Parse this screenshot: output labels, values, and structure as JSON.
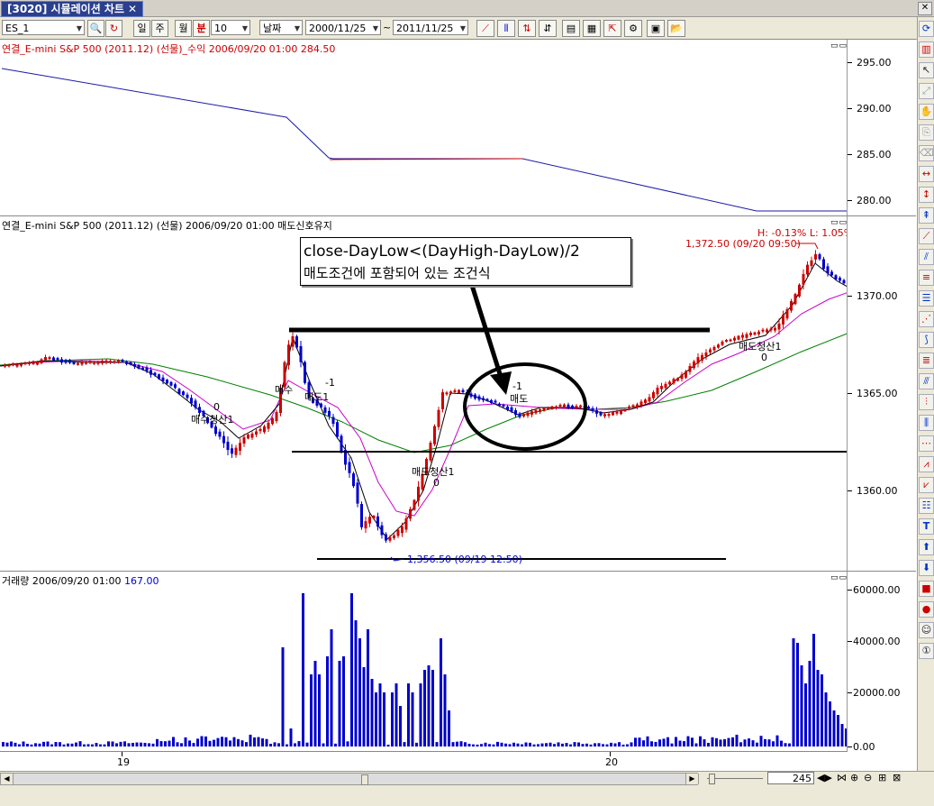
{
  "window": {
    "tab_title": "[3020] 시뮬레이션 차트",
    "close": "✕"
  },
  "toolbar": {
    "symbol": "ES_1",
    "period_btns": [
      "일",
      "주",
      "월",
      "분"
    ],
    "interval": "10",
    "range_type": "날짜",
    "date_from": "2000/11/25",
    "tilde": "~",
    "date_to": "2011/11/25"
  },
  "pane1": {
    "title": "연결_E-mini S&P 500 (2011.12) (선물)_수익 2006/09/20 01:00 284.50",
    "y_labels": [
      "295.00",
      "290.00",
      "285.00",
      "280.00"
    ]
  },
  "pane2": {
    "title": "연결_E-mini S&P 500 (2011.12) (선물)  2006/09/20 01:00  매도신호유지",
    "y_labels": [
      "1370.00",
      "1365.00",
      "1360.00"
    ],
    "hl_label": "H: -0.13%   L: 1.05%",
    "high_label": "1,372.50 (09/20 09:50)",
    "low_label": "1,356.50 (09/19 12:50)",
    "annotation_line1": "close-DayLow<(DayHigh-DayLow)/2",
    "annotation_line2": "매도조건에 포함되어 있는 조건식",
    "signals": {
      "s1_qty": "0",
      "s1_label": "매수청산1",
      "s2_label": "매수",
      "s3_label": "매도1",
      "s3_qty": "-1",
      "s4_label": "매도청산1",
      "s4_qty": "0",
      "s5_qty": "-1",
      "s5_label": "매도",
      "s6_label": "매도청산1",
      "s6_qty": "0"
    }
  },
  "pane3": {
    "title_prefix": "거래량  2006/09/20 01:00 ",
    "title_value": "167.00",
    "y_labels": [
      "60000.00",
      "40000.00",
      "20000.00",
      "0.00"
    ]
  },
  "x_axis": {
    "labels": [
      "19",
      "20"
    ]
  },
  "statusbar": {
    "zoom_value": "245"
  },
  "colors": {
    "up": "#cc0000",
    "down": "#0000cc",
    "ma_short": "#000000",
    "ma_mid": "#cc00cc",
    "ma_long": "#008000",
    "equity": "#1a1aa8"
  }
}
